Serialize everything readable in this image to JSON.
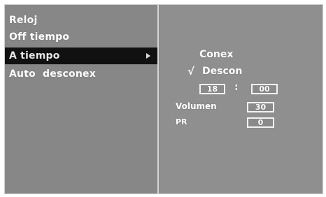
{
  "menu": {
    "items": [
      {
        "label": "Reloj"
      },
      {
        "label": "Off tiempo"
      },
      {
        "label": "A tiempo",
        "selected": true
      },
      {
        "label": "Auto  desconex"
      }
    ]
  },
  "detail": {
    "option_on": "Conex",
    "option_off": "Descon",
    "selected_option": "Descon",
    "hour": "18",
    "separator": ":",
    "minute": "00",
    "volume_label": "Volumen",
    "volume_value": "30",
    "pr_label": "PR",
    "pr_value": "0"
  },
  "icons": {
    "submenu": "chevron-right-icon",
    "selected": "check-icon"
  },
  "colors": {
    "background": "#8c8c8c",
    "highlight": "#111111",
    "text": "#ffffff"
  }
}
